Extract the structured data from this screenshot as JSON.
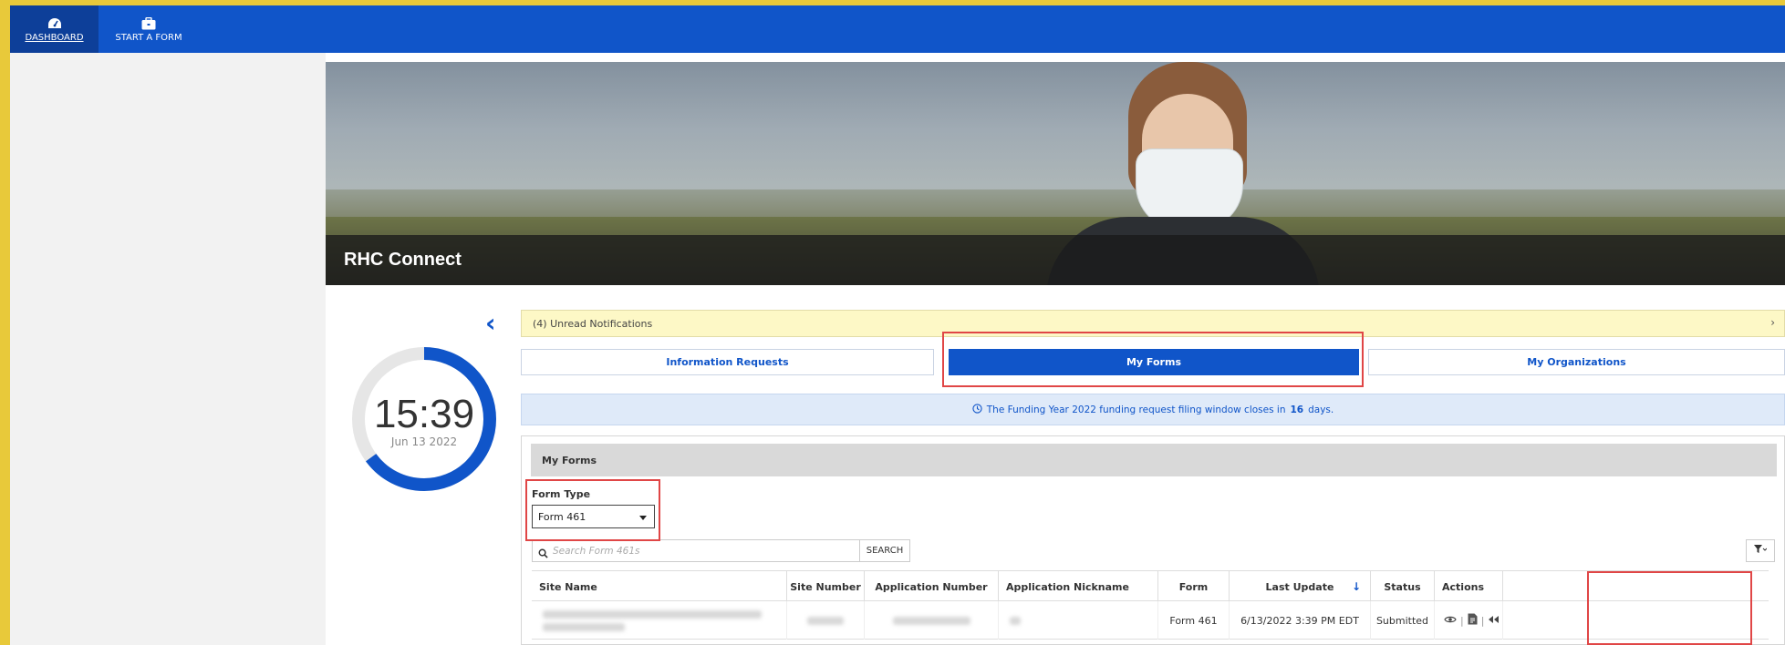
{
  "nav": {
    "dashboard_label": "DASHBOARD",
    "start_form_label": "START A FORM",
    "dashboard_icon": "dashboard-gauge-icon",
    "start_form_icon": "briefcase-icon"
  },
  "hero": {
    "title": "RHC Connect"
  },
  "clock": {
    "time": "15:39",
    "date": "Jun 13 2022",
    "progress": 0.65
  },
  "notifications": {
    "text": "(4) Unread Notifications"
  },
  "tabs": {
    "information_requests": "Information Requests",
    "my_forms": "My Forms",
    "my_organizations": "My Organizations"
  },
  "banner": {
    "prefix": "The Funding Year 2022 funding request filing window closes in",
    "days": "16",
    "suffix": "days."
  },
  "panel": {
    "title": "My Forms",
    "form_type_label": "Form Type",
    "form_type_value": "Form 461",
    "search_placeholder": "Search Form 461s",
    "search_button": "SEARCH"
  },
  "table": {
    "headers": {
      "site_name": "Site Name",
      "site_number": "Site Number",
      "application_number": "Application Number",
      "application_nickname": "Application Nickname",
      "form": "Form",
      "last_update": "Last Update",
      "status": "Status",
      "actions": "Actions"
    },
    "rows": [
      {
        "form": "Form 461",
        "last_update": "6/13/2022 3:39 PM EDT",
        "status": "Submitted"
      }
    ]
  },
  "colors": {
    "brand_blue": "#1055c9",
    "highlight_red": "#e04646",
    "frame_yellow": "#e8c93a"
  }
}
